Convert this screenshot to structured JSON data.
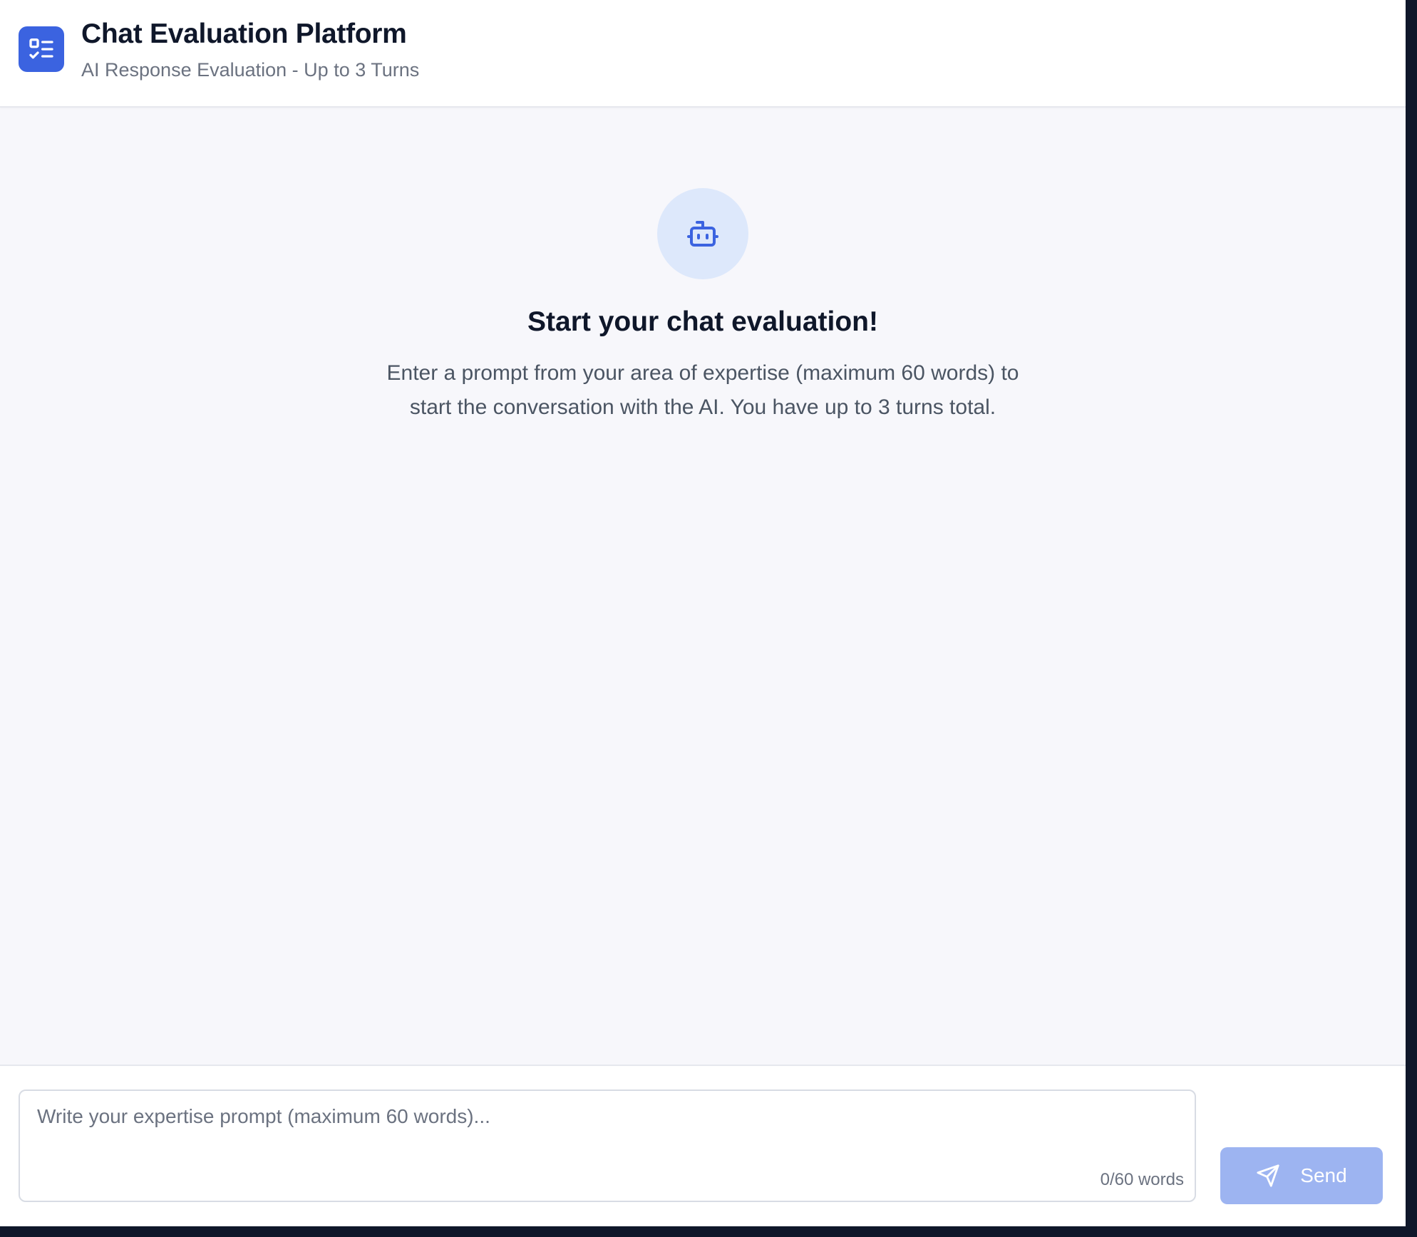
{
  "header": {
    "title": "Chat Evaluation Platform",
    "subtitle": "AI Response Evaluation - Up to 3 Turns",
    "logo_icon": "checklist-icon"
  },
  "empty_state": {
    "icon": "bot-icon",
    "title": "Start your chat evaluation!",
    "description": "Enter a prompt from your area of expertise (maximum 60 words) to start the conversation with the AI. You have up to 3 turns total."
  },
  "composer": {
    "placeholder": "Write your expertise prompt (maximum 60 words)...",
    "value": "",
    "word_count": "0/60 words",
    "send_label": "Send",
    "send_icon": "send-icon",
    "send_disabled": true
  },
  "colors": {
    "accent": "#3b63e0",
    "send_disabled_bg": "#9db4f1",
    "bot_circle_bg": "#dde8fb",
    "page_bg": "#f7f7fb"
  }
}
